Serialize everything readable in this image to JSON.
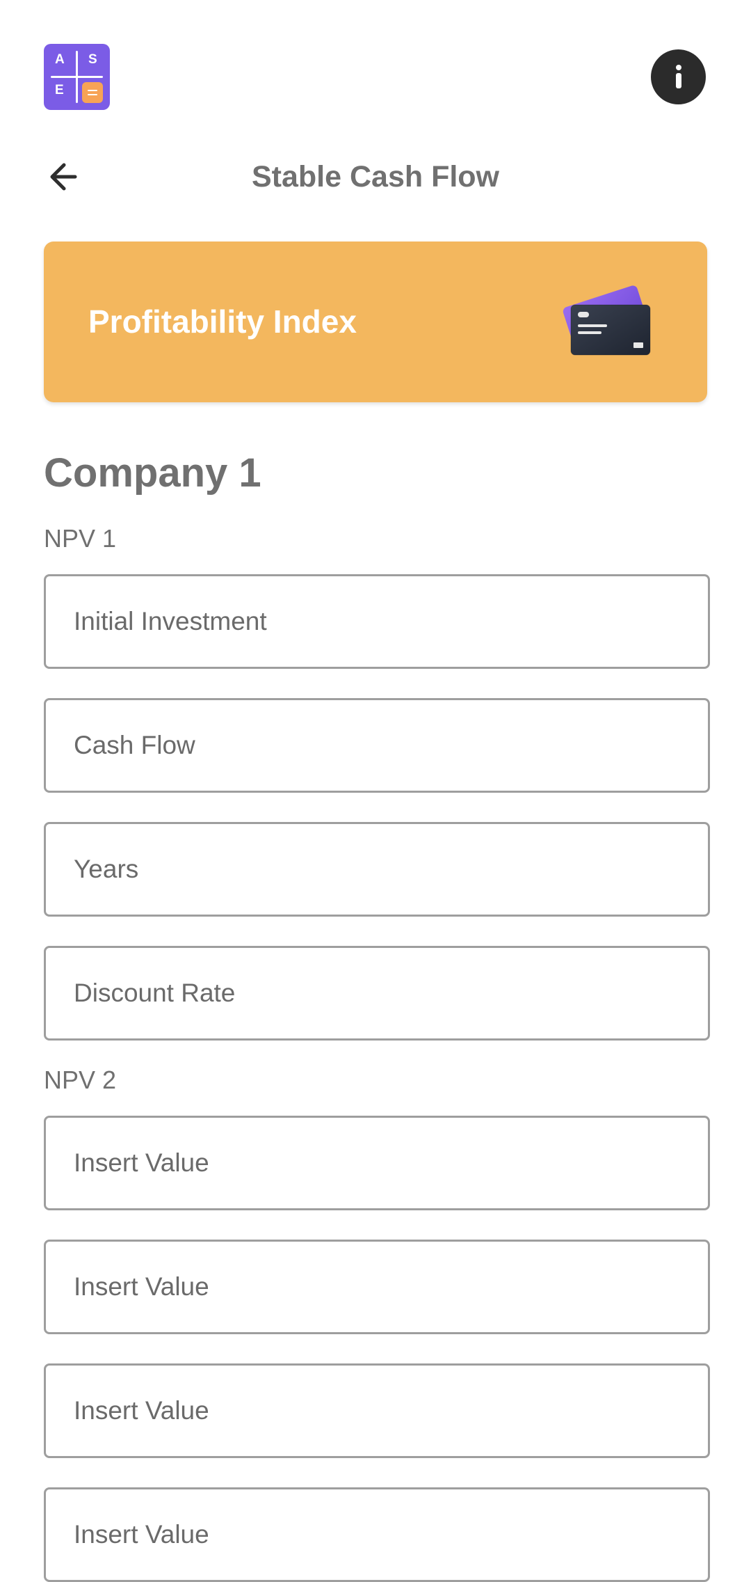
{
  "header": {
    "logo": {
      "letters": [
        "A",
        "S",
        "E"
      ],
      "colors": {
        "background": "#7b5ce6",
        "accent": "#f7a356"
      }
    },
    "info_icon": "info-icon",
    "back_icon": "arrow-left-icon",
    "title": "Stable Cash Flow"
  },
  "banner": {
    "title": "Profitability Index",
    "icon": "credit-card-icon",
    "color": "#f3b75e"
  },
  "section": {
    "title": "Company 1",
    "groups": [
      {
        "label": "NPV 1",
        "fields": [
          {
            "placeholder": "Initial Investment",
            "value": ""
          },
          {
            "placeholder": "Cash Flow",
            "value": ""
          },
          {
            "placeholder": "Years",
            "value": ""
          },
          {
            "placeholder": "Discount Rate",
            "value": ""
          }
        ]
      },
      {
        "label": "NPV 2",
        "fields": [
          {
            "placeholder": "Insert Value",
            "value": ""
          },
          {
            "placeholder": "Insert Value",
            "value": ""
          },
          {
            "placeholder": "Insert Value",
            "value": ""
          },
          {
            "placeholder": "Insert Value",
            "value": ""
          }
        ]
      }
    ]
  }
}
